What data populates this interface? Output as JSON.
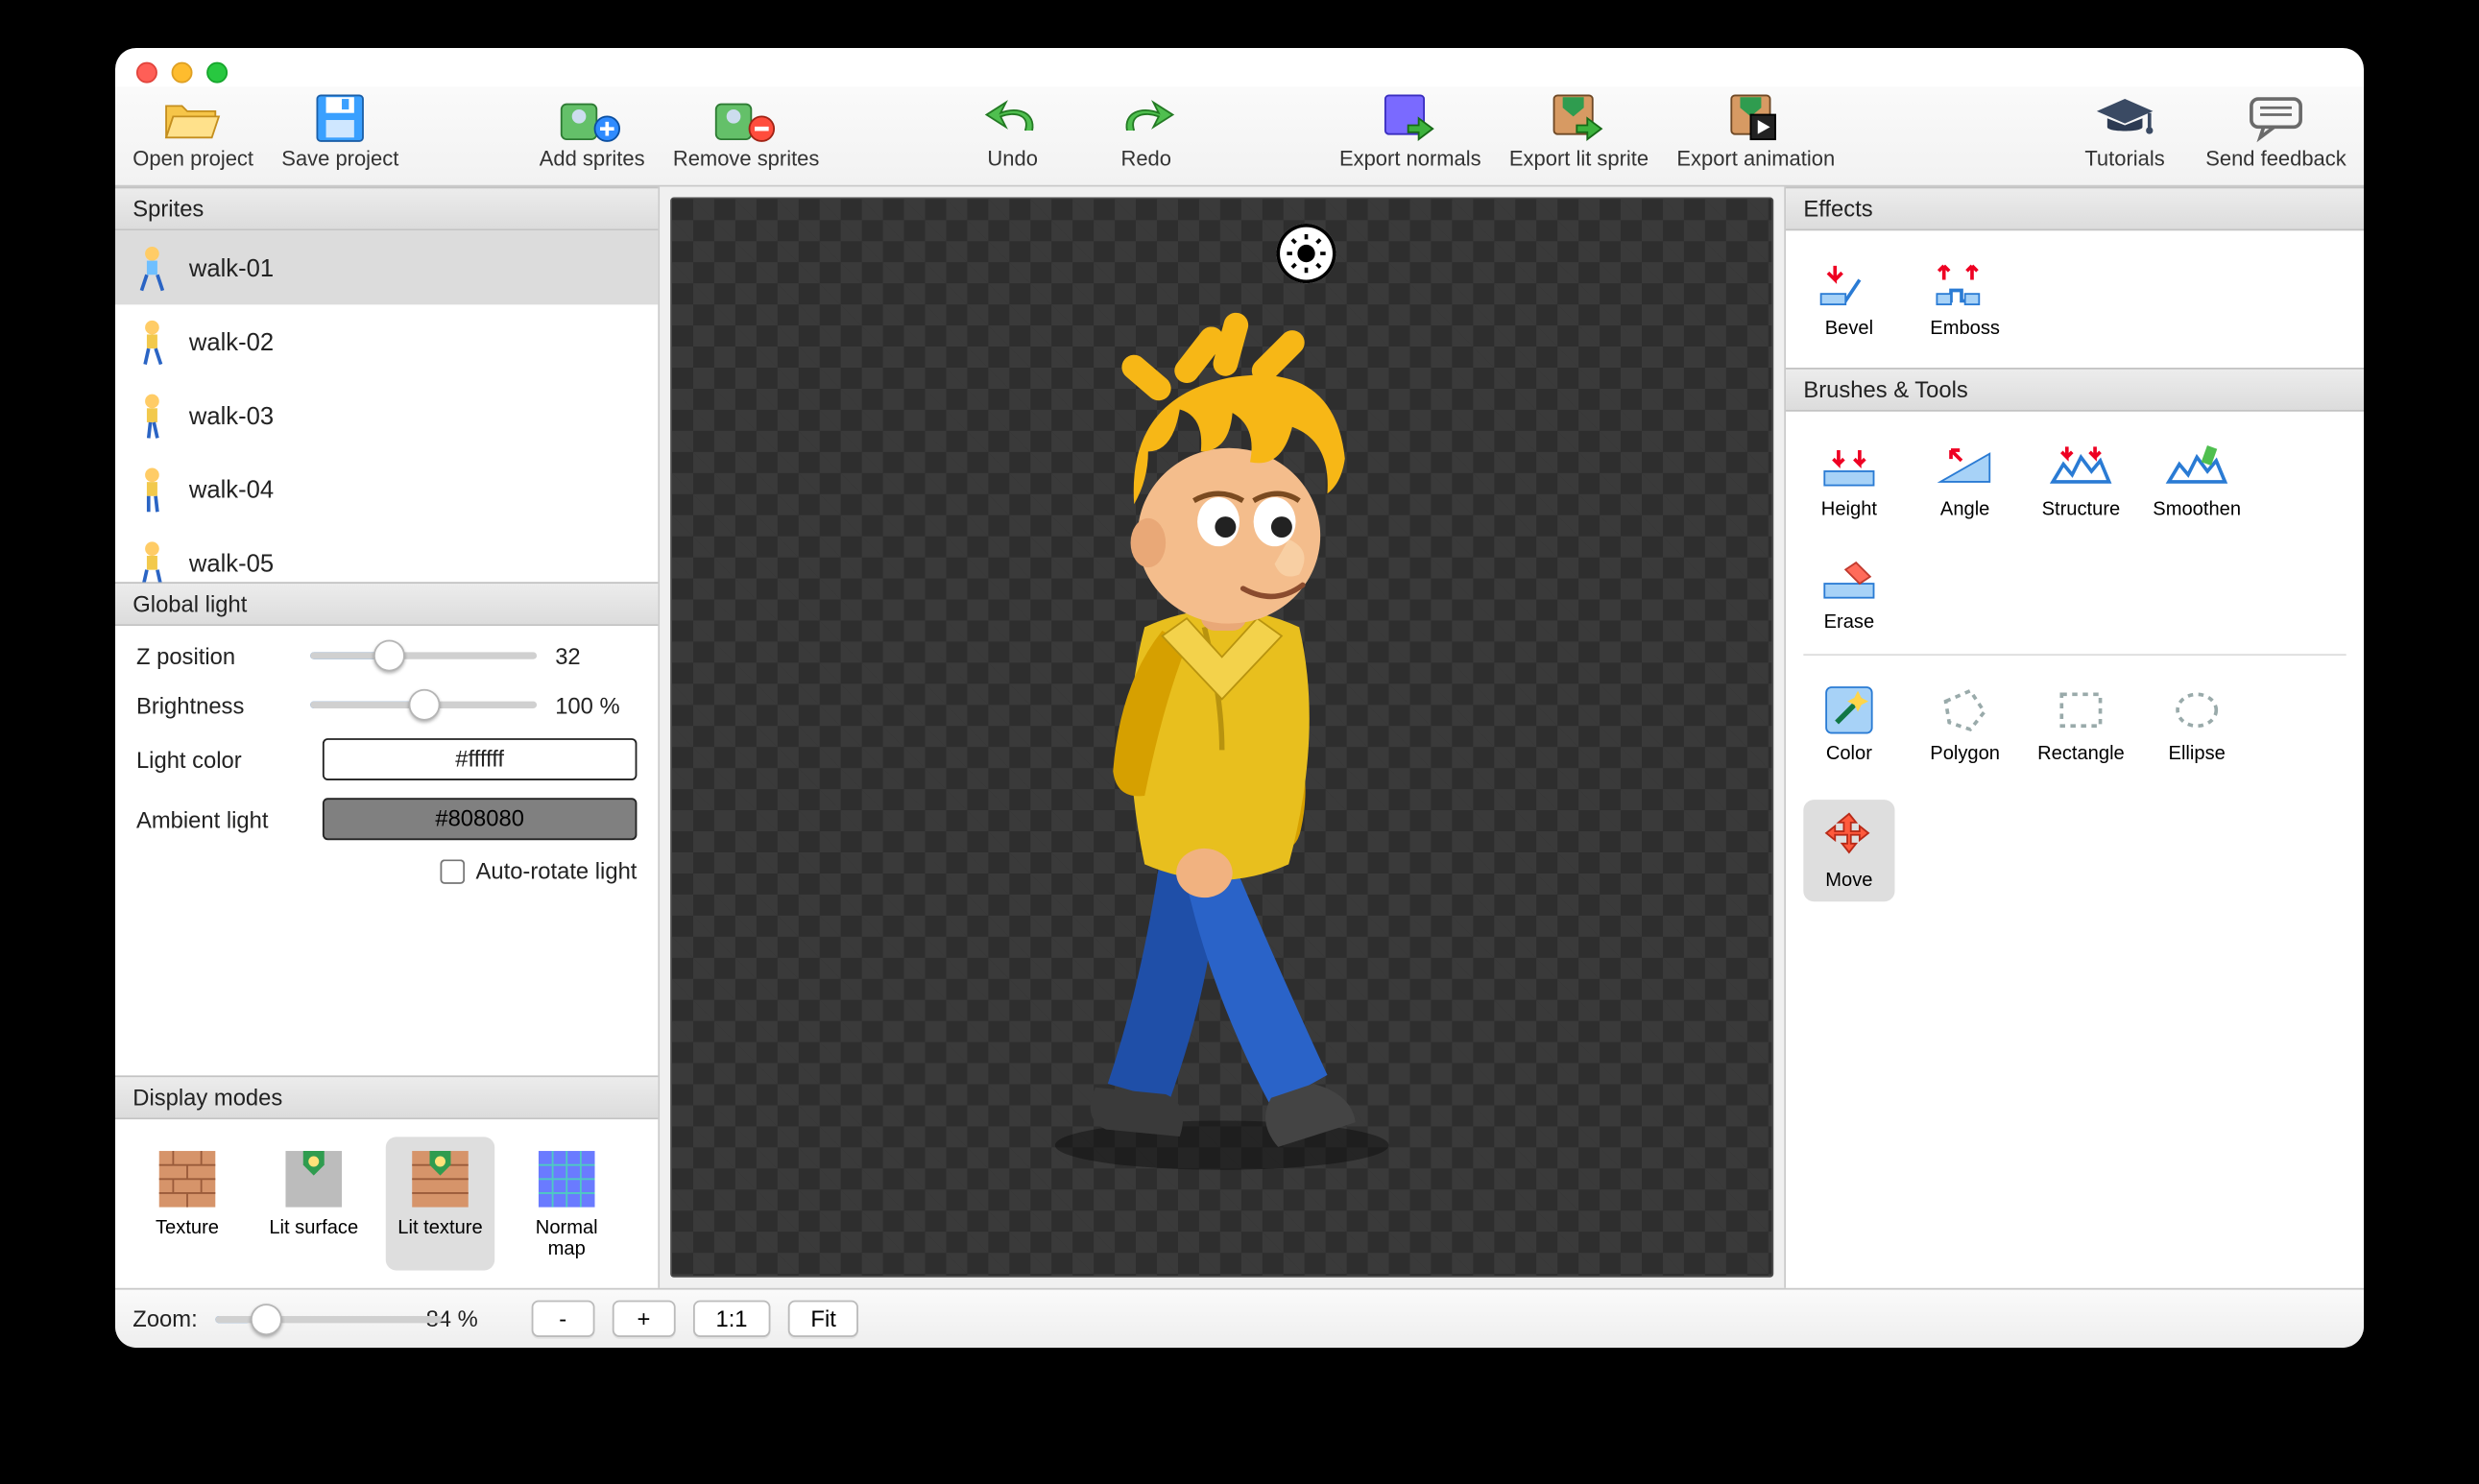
{
  "toolbar": {
    "open_project": "Open project",
    "save_project": "Save project",
    "add_sprites": "Add sprites",
    "remove_sprites": "Remove sprites",
    "undo": "Undo",
    "redo": "Redo",
    "export_normals": "Export normals",
    "export_lit_sprite": "Export lit sprite",
    "export_animation": "Export animation",
    "tutorials": "Tutorials",
    "send_feedback": "Send feedback"
  },
  "panels": {
    "sprites": "Sprites",
    "global_light": "Global light",
    "display_modes": "Display modes",
    "effects": "Effects",
    "brushes": "Brushes & Tools"
  },
  "sprites": {
    "items": [
      {
        "label": "walk-01",
        "selected": true
      },
      {
        "label": "walk-02",
        "selected": false
      },
      {
        "label": "walk-03",
        "selected": false
      },
      {
        "label": "walk-04",
        "selected": false
      },
      {
        "label": "walk-05",
        "selected": false
      }
    ]
  },
  "global_light": {
    "z_position": {
      "label": "Z position",
      "value": "32",
      "percent": 32
    },
    "brightness": {
      "label": "Brightness",
      "value": "100 %",
      "percent": 45
    },
    "light_color": {
      "label": "Light color",
      "value": "#ffffff",
      "bg": "#ffffff"
    },
    "ambient_light": {
      "label": "Ambient light",
      "value": "#808080",
      "bg": "#808080"
    },
    "auto_rotate": {
      "label": "Auto-rotate light",
      "checked": false
    }
  },
  "display_modes": {
    "items": [
      {
        "label": "Texture",
        "selected": false
      },
      {
        "label": "Lit surface",
        "selected": false
      },
      {
        "label": "Lit texture",
        "selected": true
      },
      {
        "label": "Normal map",
        "selected": false
      }
    ]
  },
  "zoom": {
    "label": "Zoom:",
    "value": "84 %",
    "percent": 18,
    "minus": "-",
    "plus": "+",
    "one": "1:1",
    "fit": "Fit"
  },
  "effects": {
    "items": [
      {
        "label": "Bevel"
      },
      {
        "label": "Emboss"
      }
    ]
  },
  "brushes": {
    "row1": [
      {
        "label": "Height"
      },
      {
        "label": "Angle"
      },
      {
        "label": "Structure"
      },
      {
        "label": "Smoothen"
      },
      {
        "label": "Erase"
      }
    ],
    "row2": [
      {
        "label": "Color"
      },
      {
        "label": "Polygon"
      },
      {
        "label": "Rectangle"
      },
      {
        "label": "Ellipse"
      },
      {
        "label": "Move",
        "selected": true
      }
    ]
  }
}
